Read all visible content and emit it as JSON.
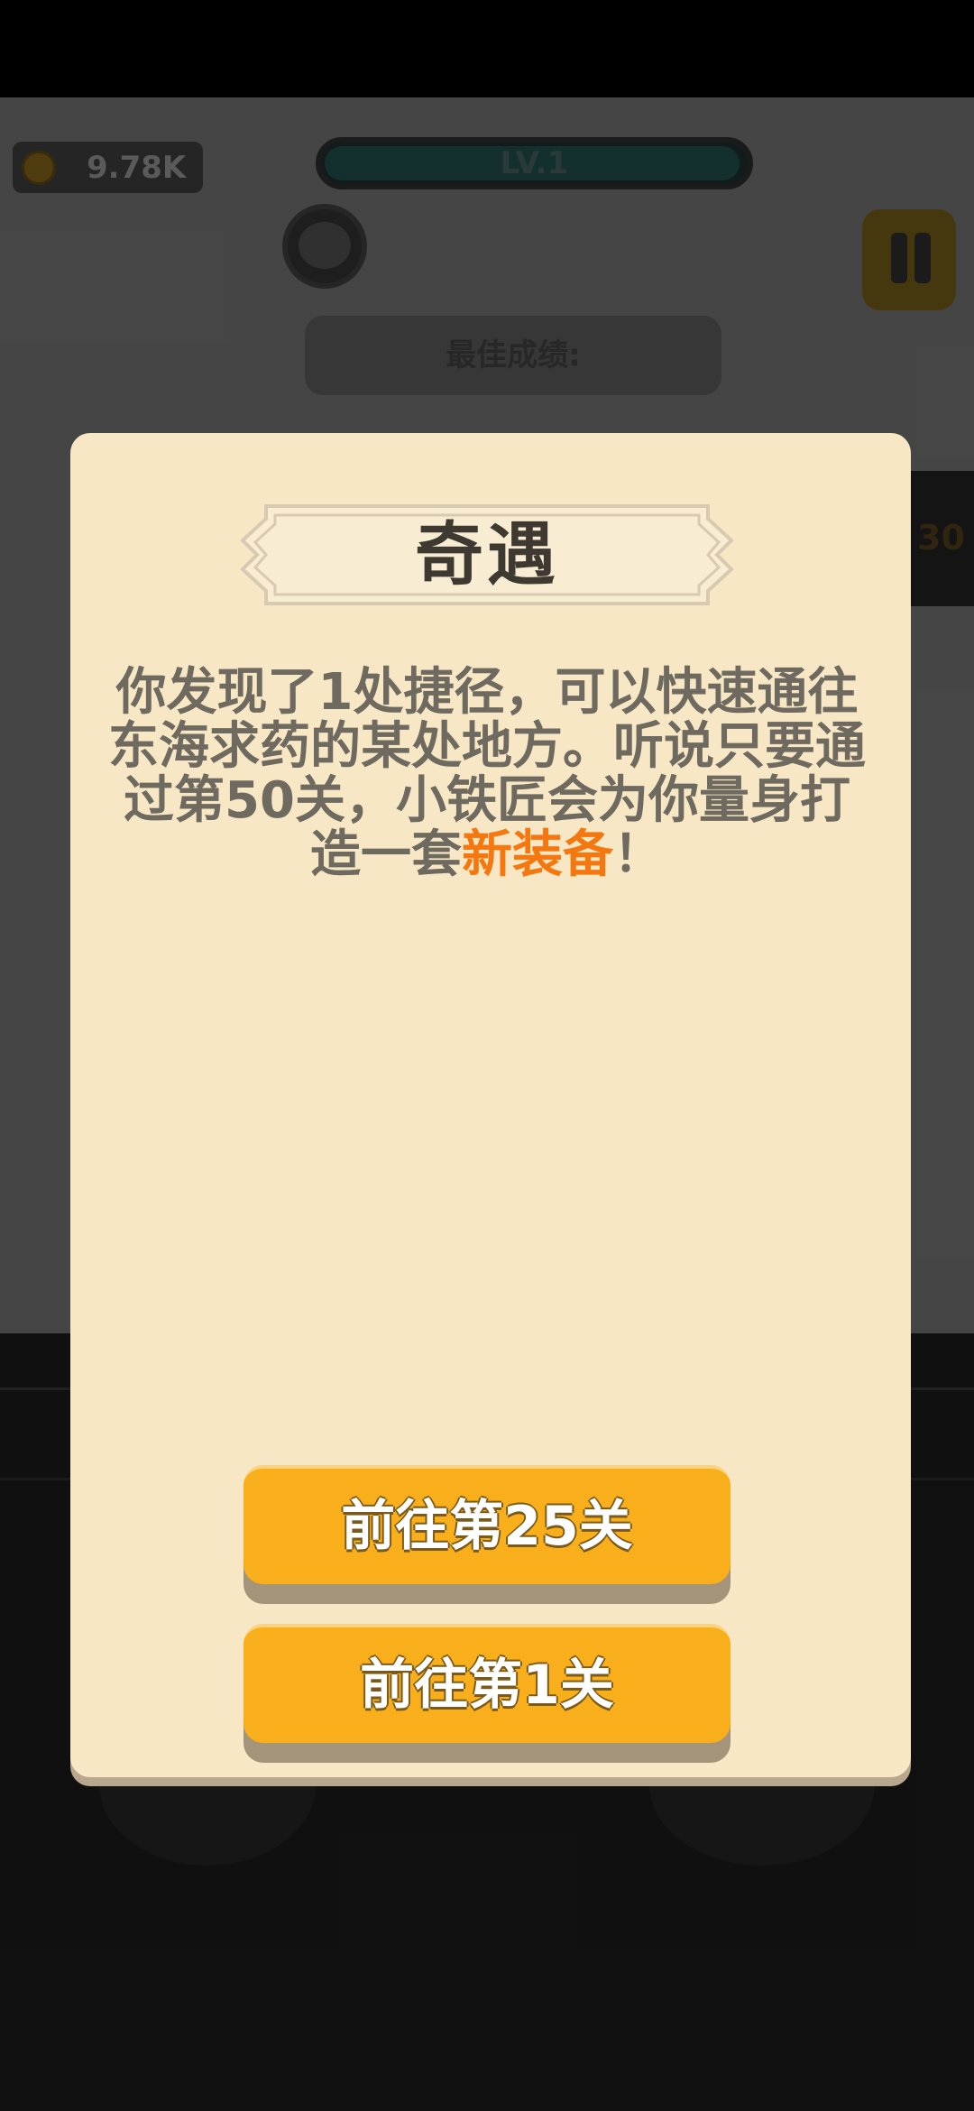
{
  "hud": {
    "coins": "9.78K",
    "level": "LV.1",
    "best_score_label": "最佳成绩:",
    "right_panel_value": "30"
  },
  "dialog": {
    "title": "奇遇",
    "message_part1": "你发现了1处捷径，可以快速通往东海求药的某处地方。听说只要通过第50关，小铁匠会为你量身打造一套",
    "message_highlight": "新装备",
    "message_part2": "！",
    "buttons": {
      "go_25": "前往第25关",
      "go_1": "前往第1关"
    }
  },
  "colors": {
    "dialog_bg": "#f8e7c4",
    "button": "#f9ae1c",
    "highlight": "#f4770f"
  }
}
